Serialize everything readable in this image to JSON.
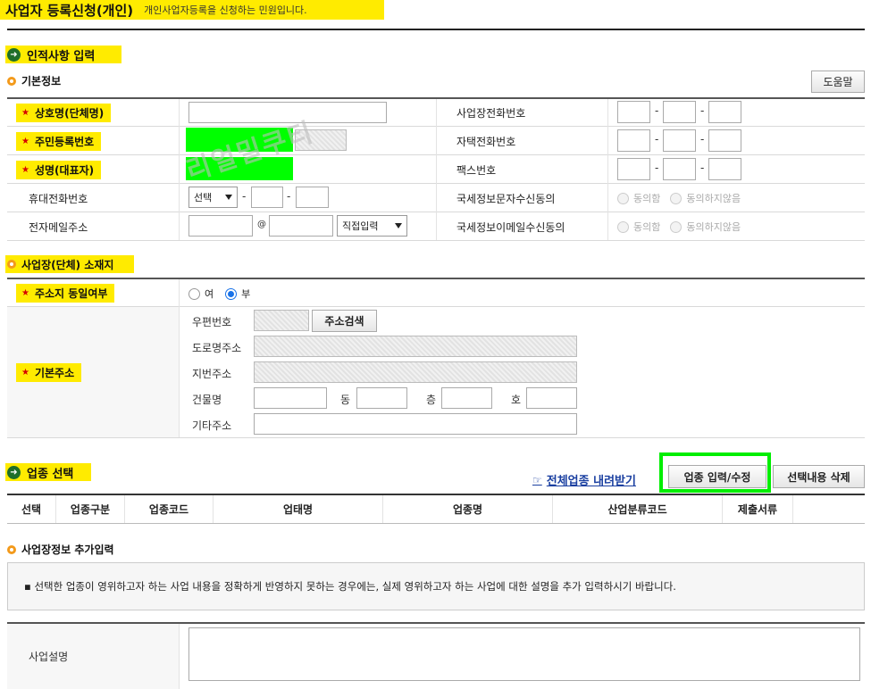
{
  "page": {
    "title": "사업자 등록신청(개인)",
    "subtitle": "개인사업자등록을 신청하는 민원입니다."
  },
  "section1": {
    "title": "인적사항 입력",
    "basic_info": "기본정보",
    "help_button": "도움말",
    "fields": {
      "company_name": "상호명(단체명)",
      "resident_number": "주민등록번호",
      "representative": "성명(대표자)",
      "mobile": "휴대전화번호",
      "email": "전자메일주소",
      "business_phone": "사업장전화번호",
      "home_phone": "자택전화번호",
      "fax": "팩스번호",
      "sms_consent": "국세정보문자수신동의",
      "email_consent": "국세정보이메일수신동의"
    },
    "mobile_select": "선택",
    "email_at": "@",
    "email_domain_select": "직접입력",
    "dash": "-",
    "consent_yes": "동의함",
    "consent_no": "동의하지않음",
    "watermark": "리얼밀쿠티"
  },
  "section2": {
    "title": "사업장(단체) 소재지",
    "same_address": "주소지 동일여부",
    "same_yes": "여",
    "same_no": "부",
    "base_address": "기본주소",
    "postal_code": "우편번호",
    "address_search_button": "주소검색",
    "road_address": "도로명주소",
    "lot_address": "지번주소",
    "building": "건물명",
    "dong": "동",
    "floor": "층",
    "ho": "호",
    "other_address": "기타주소"
  },
  "section3": {
    "title": "업종 선택",
    "download_link": "전체업종 내려받기",
    "input_button": "업종 입력/수정",
    "delete_button": "선택내용 삭제",
    "columns": [
      "선택",
      "업종구분",
      "업종코드",
      "업태명",
      "업종명",
      "산업분류코드",
      "제출서류"
    ]
  },
  "section4": {
    "title": "사업장정보 추가입력",
    "notice": "▪ 선택한 업종이 영위하고자 하는 사업 내용을 정확하게 반영하지 못하는 경우에는, 실제 영위하고자 하는 사업에 대한 설명을 추가 입력하시기 바랍니다.",
    "business_description": "사업설명"
  },
  "colors": {
    "highlight": "#ffeb00",
    "masked": "#00ff00",
    "section_icon": "#1f6e2a",
    "required_star": "#d60000"
  }
}
